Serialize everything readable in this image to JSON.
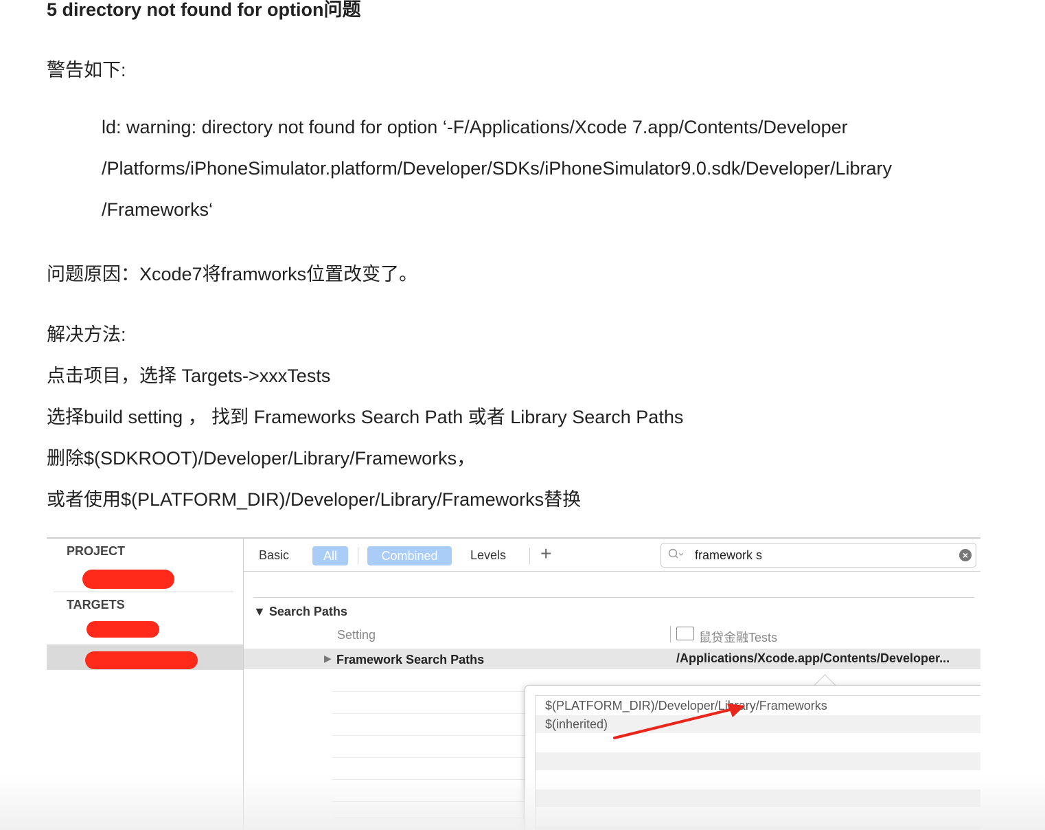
{
  "heading": "5 directory not found for option问题",
  "warning_label": "警告如下:",
  "warning_lines": [
    "ld: warning: directory not found for option ‘-F/Applications/Xcode 7.app/Contents/Developer",
    "/Platforms/iPhoneSimulator.platform/Developer/SDKs/iPhoneSimulator9.0.sdk/Developer/Library",
    "/Frameworks‘"
  ],
  "cause": "问题原因：Xcode7将framworks位置改变了。",
  "solution_label": "解决方法:",
  "steps": [
    "点击项目，选择 Targets->xxxTests",
    "选择build setting ， 找到 Frameworks Search Path 或者 Library Search Paths",
    "删除$(SDKROOT)/Developer/Library/Frameworks，",
    "或者使用$(PLATFORM_DIR)/Developer/Library/Frameworks替换"
  ],
  "xcode": {
    "sidebar": {
      "project_label": "PROJECT",
      "targets_label": "TARGETS"
    },
    "toolbar": {
      "basic": "Basic",
      "all": "All",
      "combined": "Combined",
      "levels": "Levels",
      "plus": "+"
    },
    "search": {
      "value": "framework s"
    },
    "section_title": "Search Paths",
    "column_setting": "Setting",
    "column_target": "鼠贷金融Tests",
    "row": {
      "name": "Framework Search Paths",
      "value": "/Applications/Xcode.app/Contents/Developer..."
    },
    "popup_items": [
      "$(PLATFORM_DIR)/Developer/Library/Frameworks",
      "$(inherited)"
    ],
    "colors": {
      "redaction": "#ff2a1a",
      "selected_pill": "#a9cdf6",
      "arrow": "#e8261c"
    }
  }
}
